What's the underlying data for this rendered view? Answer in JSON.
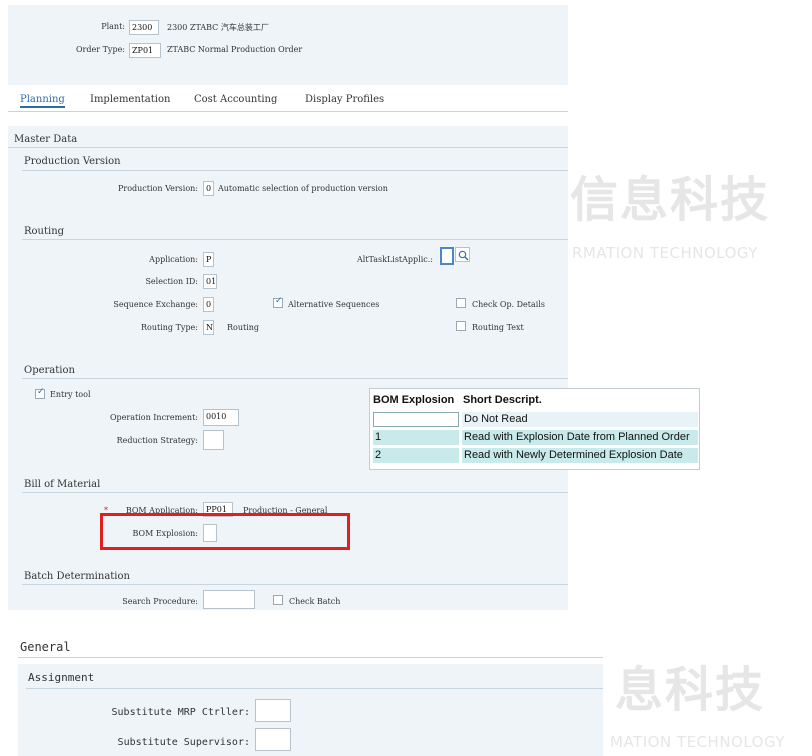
{
  "header": {
    "plant_label": "Plant:",
    "plant_value": "2300",
    "plant_desc": "2300 ZTABC 汽车总装工厂",
    "order_type_label": "Order Type:",
    "order_type_value": "ZP01",
    "order_type_desc": "ZTABC Normal Production Order"
  },
  "tabs": [
    "Planning",
    "Implementation",
    "Cost Accounting",
    "Display Profiles"
  ],
  "master_data": {
    "title": "Master Data",
    "production_version": {
      "title": "Production Version",
      "label": "Production Version:",
      "value": "0",
      "desc": "Automatic selection of production version"
    },
    "routing": {
      "title": "Routing",
      "application_label": "Application:",
      "application_value": "P",
      "alt_task_label": "AltTaskListApplic.:",
      "alt_task_value": "",
      "selection_id_label": "Selection ID:",
      "selection_id_value": "01",
      "sequence_exchange_label": "Sequence Exchange:",
      "sequence_exchange_value": "0",
      "alternative_sequences_label": "Alternative Sequences",
      "alternative_sequences_checked": true,
      "check_op_label": "Check Op. Details",
      "check_op_checked": false,
      "routing_type_label": "Routing Type:",
      "routing_type_value": "N",
      "routing_type_desc": "Routing",
      "routing_text_label": "Routing Text",
      "routing_text_checked": false
    },
    "operation": {
      "title": "Operation",
      "entry_tool_label": "Entry tool",
      "entry_tool_checked": true,
      "increment_label": "Operation Increment:",
      "increment_value": "0010",
      "reduction_label": "Reduction Strategy:",
      "reduction_value": ""
    },
    "bom": {
      "title": "Bill of Material",
      "application_label": "BOM Application:",
      "application_value": "PP01",
      "application_desc": "Production - General",
      "explosion_label": "BOM Explosion:",
      "explosion_value": ""
    },
    "batch": {
      "title": "Batch Determination",
      "search_label": "Search Procedure:",
      "search_value": "",
      "check_batch_label": "Check Batch",
      "check_batch_checked": false
    }
  },
  "general": {
    "title": "General",
    "assignment_title": "Assignment",
    "sub_mrp_label": "Substitute MRP Ctrller:",
    "sub_mrp_value": "",
    "sub_sup_label": "Substitute Supervisor:",
    "sub_sup_value": ""
  },
  "f4_help": {
    "headers": [
      "BOM Explosion",
      "Short Descript."
    ],
    "rows": [
      {
        "key": "",
        "desc": "Do Not Read"
      },
      {
        "key": "1",
        "desc": "Read with Explosion Date from Planned Order"
      },
      {
        "key": "2",
        "desc": "Read with Newly Determined Explosion Date"
      }
    ]
  },
  "watermarks": [
    "信息科技",
    "RMATION TECHNOLOGY",
    "息科技",
    "MATION TECHNOLOGY"
  ],
  "colors": {
    "accent": "#2a6cb0",
    "panel": "#eef4f8",
    "f4_row": "#c8eaea",
    "highlight": "#e02020"
  },
  "icons": {
    "search": "magnifier-icon"
  }
}
